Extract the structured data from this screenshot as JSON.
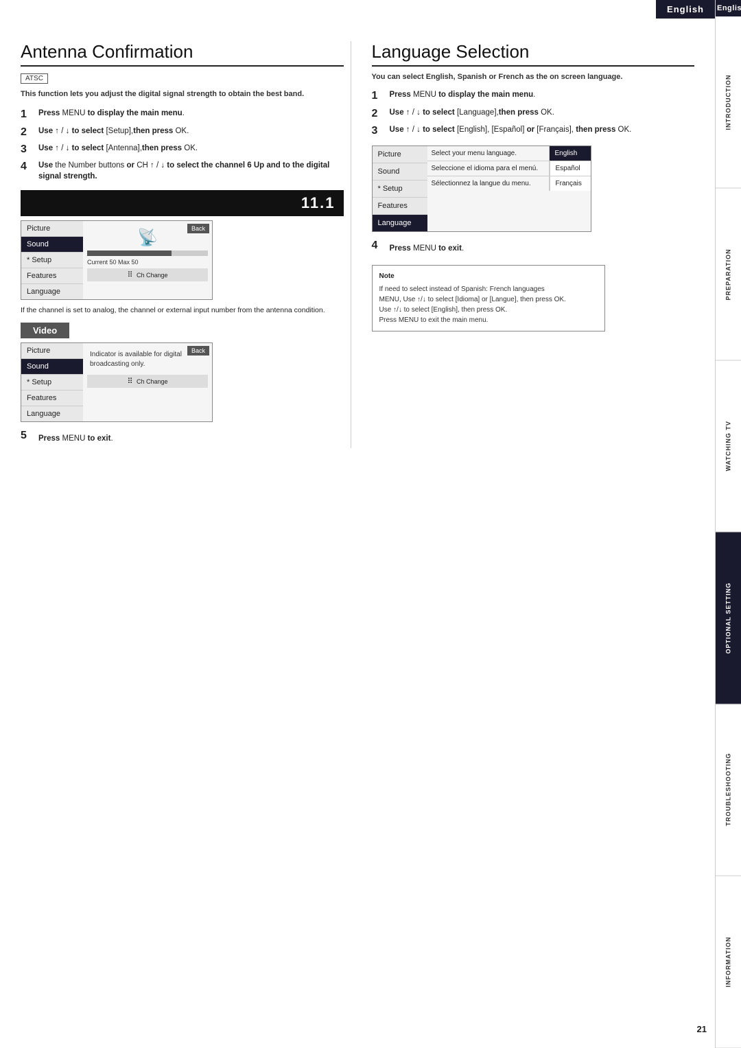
{
  "english_label": "English",
  "page_number": "21",
  "sidebar": {
    "sections": [
      {
        "label": "INTRODUCTION",
        "highlighted": false
      },
      {
        "label": "PREPARATION",
        "highlighted": false
      },
      {
        "label": "WATCHING TV",
        "highlighted": false
      },
      {
        "label": "OPTIONAL SETTING",
        "highlighted": true
      },
      {
        "label": "TROUBLESHOOTING",
        "highlighted": false
      },
      {
        "label": "INFORMATION",
        "highlighted": false
      }
    ]
  },
  "antenna": {
    "title": "Antenna Confirmation",
    "badge": "ATSC",
    "intro": "This function lets you adjust the digital signal strength to obtain the best band.",
    "steps": [
      {
        "num": "1",
        "text": "Press MENU to display the main menu."
      },
      {
        "num": "2",
        "text": "Use ↑/↓ to select [Setup], then press OK."
      },
      {
        "num": "3",
        "text": "Use ↑/↓ to select [Antenna], then press OK."
      },
      {
        "num": "4",
        "text": "Use the Number buttons or CH ↑/↓ to select the channel 6 Up and to the digital signal strength."
      }
    ],
    "channel_display": "11.1",
    "menu1": {
      "items": [
        "Picture",
        "Sound",
        "* Setup",
        "Features",
        "Language"
      ],
      "active": "* Setup",
      "back_label": "Back",
      "current_label": "Current 50  Max    50"
    },
    "caption": "If the channel is set to analog, the channel or external input number from the antenna condition.",
    "video_label": "Video",
    "menu2": {
      "items": [
        "Picture",
        "Sound",
        "* Setup",
        "Features",
        "Language"
      ],
      "active": "* Setup",
      "back_label": "Back",
      "digital_text": "Indicator is available for digital broadcasting only."
    },
    "step5": "Press MENU to exit."
  },
  "language": {
    "title": "Language Selection",
    "intro": "You can select English, Spanish or French as the on screen language.",
    "steps": [
      {
        "num": "1",
        "text": "Press MENU to display the main menu."
      },
      {
        "num": "2",
        "text": "Use ↑/↓ to select [Language], then press OK."
      },
      {
        "num": "3",
        "text": "Use ↑/↓ to select [English], [Español] or [Français], then press OK."
      }
    ],
    "menu": {
      "items": [
        "Picture",
        "Sound",
        "* Setup",
        "Features",
        "Language"
      ],
      "active": "Language",
      "rows": [
        {
          "desc": "Select your menu language.",
          "value": "English",
          "value_style": "highlighted"
        },
        {
          "desc": "Seleccione el idioma para el menú.",
          "value": "Español",
          "value_style": "normal"
        },
        {
          "desc": "Sélectionnez la langue du menu.",
          "value": "Français",
          "value_style": "normal"
        }
      ]
    },
    "step4": "Press MENU to exit.",
    "note": {
      "title": "Note",
      "lines": [
        "If need to select instead of Spanish: French languages",
        "MENU, Use ↑/↓ to select [Idioma] or [Langue], then press OK.",
        "Use ↑/↓ to select [English], then press OK.",
        "Press MENU to exit the main menu."
      ]
    }
  }
}
